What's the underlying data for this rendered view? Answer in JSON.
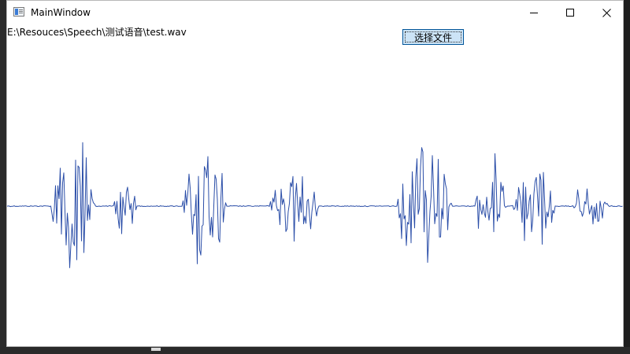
{
  "window": {
    "title": "MainWindow",
    "icon": "app-window-icon",
    "controls": [
      "minimize-icon",
      "maximize-icon",
      "close-icon"
    ]
  },
  "file": {
    "path": "E:\\Resouces\\Speech\\测试语音\\test.wav"
  },
  "toolbar": {
    "select_file_label": "选择文件"
  },
  "waveform": {
    "color": "#2b4ea8",
    "segments": [
      {
        "start": 0.071,
        "end": 0.142,
        "amplitude": 0.95
      },
      {
        "start": 0.173,
        "end": 0.21,
        "amplitude": 0.38
      },
      {
        "start": 0.285,
        "end": 0.355,
        "amplitude": 0.75
      },
      {
        "start": 0.427,
        "end": 0.505,
        "amplitude": 0.48
      },
      {
        "start": 0.632,
        "end": 0.722,
        "amplitude": 0.76
      },
      {
        "start": 0.76,
        "end": 0.81,
        "amplitude": 0.52
      },
      {
        "start": 0.82,
        "end": 0.89,
        "amplitude": 0.56
      },
      {
        "start": 0.92,
        "end": 0.975,
        "amplitude": 0.35
      }
    ]
  },
  "colors": {
    "button_bg": "#cce4f7",
    "button_border": "#005499"
  }
}
